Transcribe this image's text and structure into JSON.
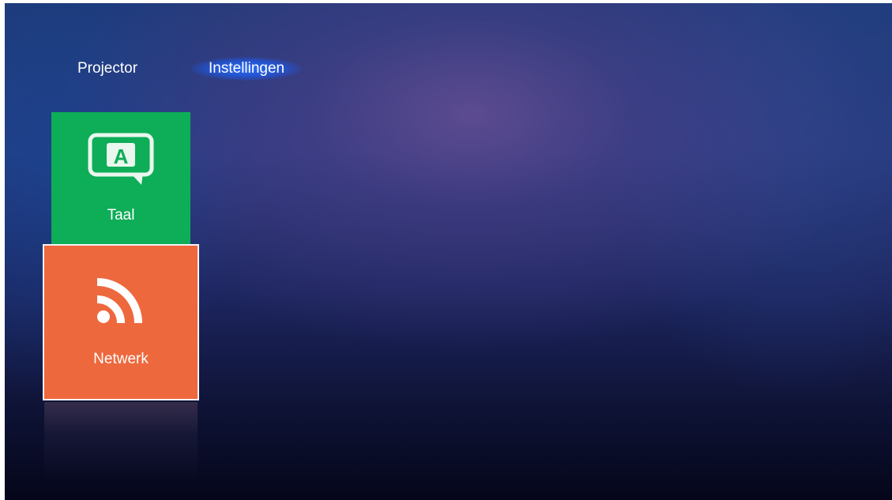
{
  "top_nav": {
    "tabs": [
      {
        "label": "Projector",
        "selected": false
      },
      {
        "label": "Instellingen",
        "selected": true
      }
    ]
  },
  "tiles": [
    {
      "label": "Taal",
      "icon": "language-icon",
      "color": "#0ead58"
    },
    {
      "label": "Netwerk",
      "icon": "network-icon",
      "color": "#ee683d",
      "focused": true
    }
  ],
  "colors": {
    "selected_tab_glow": "#2a6cff",
    "focus_border": "#f3f3f3"
  }
}
